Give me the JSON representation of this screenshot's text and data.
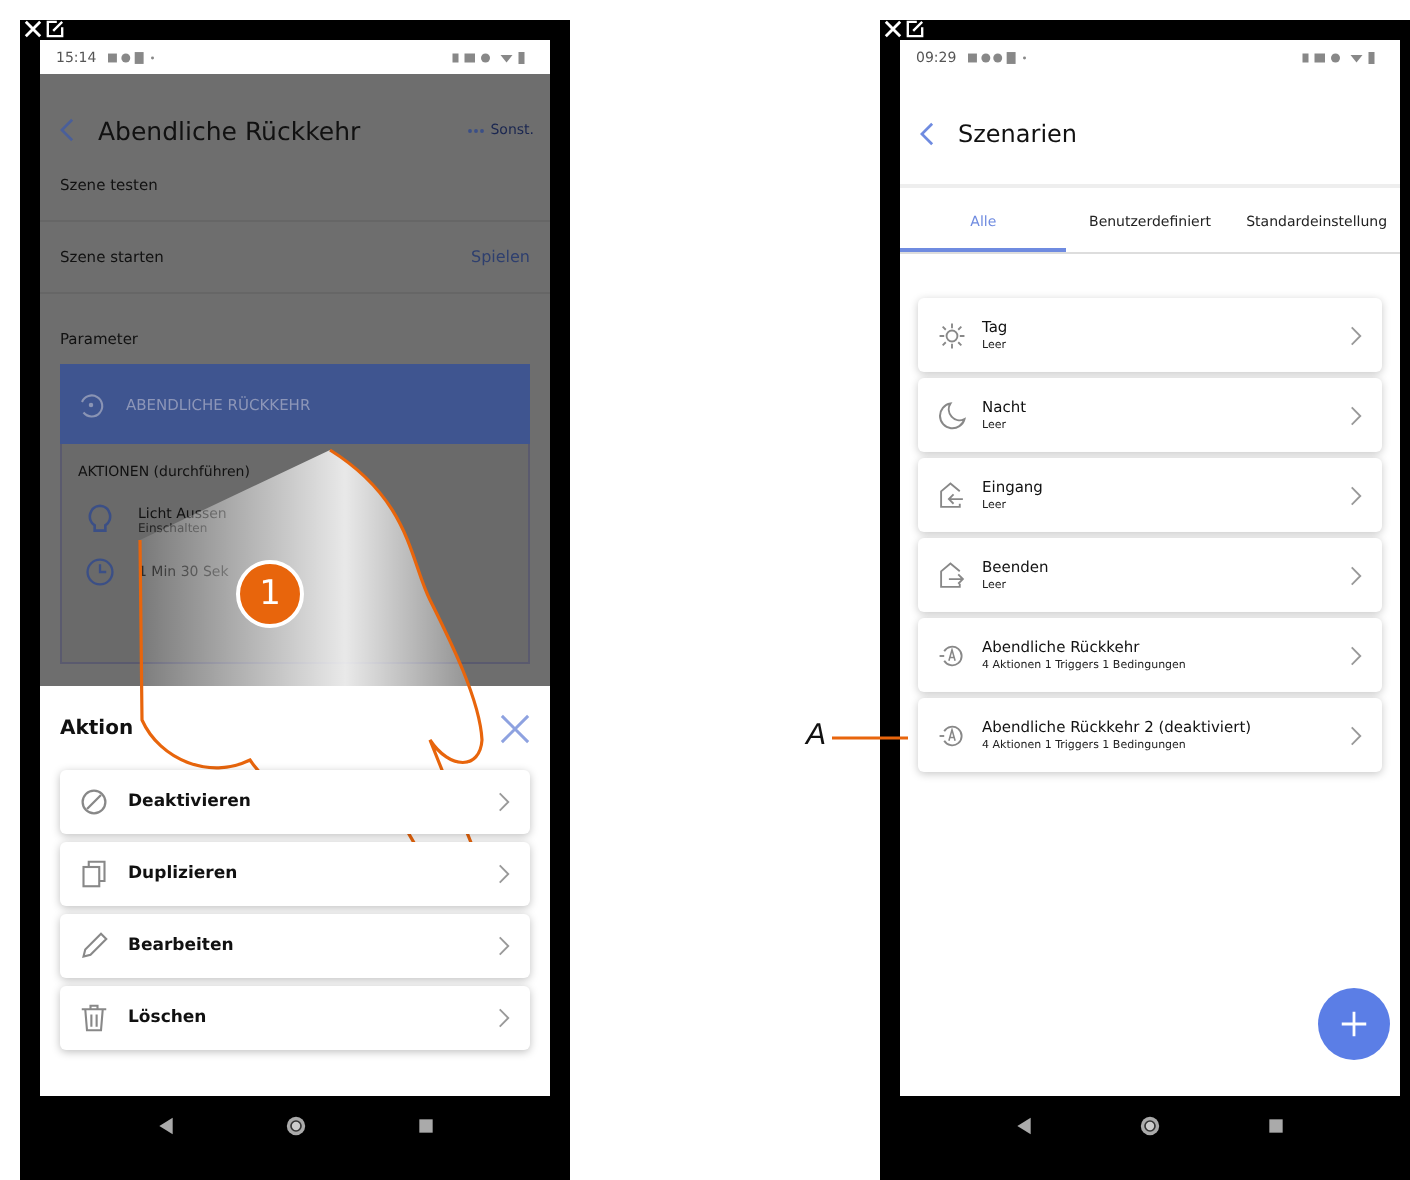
{
  "left_phone": {
    "status_bar": {
      "time": "15:14"
    },
    "header": {
      "title": "Abendliche Rückkehr",
      "menu": "Sonst."
    },
    "rows": [
      {
        "label": "Szene testen"
      },
      {
        "label": "Szene starten",
        "action": "Spielen"
      }
    ],
    "section": "Parameter",
    "scene_card": {
      "title": "ABENDLICHE RÜCKKEHR",
      "section": "AKTIONEN (durchführen)",
      "items": [
        {
          "kind": "light",
          "name": "Licht Aussen",
          "detail": "Einschalten"
        },
        {
          "kind": "timer",
          "name": "1 Min 30 Sek"
        }
      ]
    },
    "sheet": {
      "title": "Aktion",
      "items": [
        {
          "kind": "deactivate",
          "label": "Deaktivieren"
        },
        {
          "kind": "duplicate",
          "label": "Duplizieren"
        },
        {
          "kind": "edit",
          "label": "Bearbeiten"
        },
        {
          "kind": "delete",
          "label": "Löschen"
        }
      ]
    },
    "step_badge": "1"
  },
  "right_phone": {
    "status_bar": {
      "time": "09:29"
    },
    "header": {
      "title": "Szenarien"
    },
    "tabs": [
      {
        "label": "Alle",
        "selected": true
      },
      {
        "label": "Benutzerdefiniert",
        "selected": false
      },
      {
        "label": "Standardeinstellung",
        "selected": false
      }
    ],
    "scenes": [
      {
        "kind": "sun",
        "name": "Tag",
        "detail": "Leer"
      },
      {
        "kind": "moon",
        "name": "Nacht",
        "detail": "Leer"
      },
      {
        "kind": "enter",
        "name": "Eingang",
        "detail": "Leer"
      },
      {
        "kind": "exit",
        "name": "Beenden",
        "detail": "Leer"
      },
      {
        "kind": "auto",
        "name": "Abendliche Rückkehr",
        "detail": "4 Aktionen 1 Triggers 1 Bedingungen"
      },
      {
        "kind": "auto",
        "name": "Abendliche Rückkehr 2 (deaktiviert)",
        "detail": "4 Aktionen 1 Triggers 1 Bedingungen"
      }
    ]
  },
  "callout_label": "A"
}
